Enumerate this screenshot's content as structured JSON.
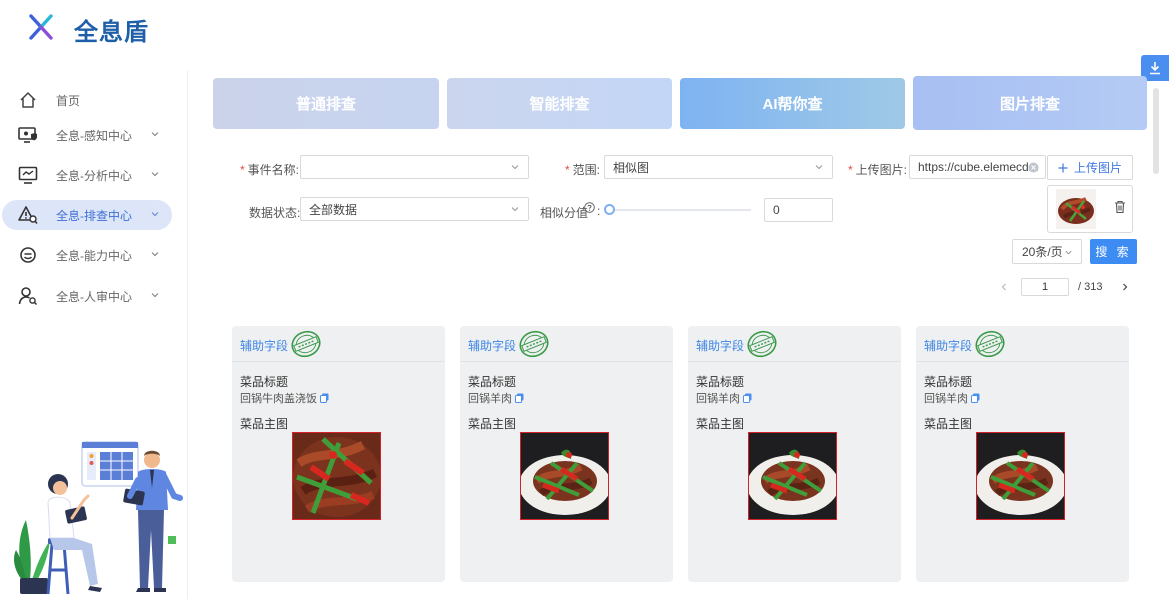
{
  "app": {
    "title": "全息盾"
  },
  "sidebar": {
    "items": [
      {
        "label": "首页",
        "icon": "home-icon",
        "active": false,
        "expandable": false
      },
      {
        "label": "全息-感知中心",
        "icon": "monitor-shield-icon",
        "active": false,
        "expandable": true
      },
      {
        "label": "全息-分析中心",
        "icon": "screen-chart-icon",
        "active": false,
        "expandable": true
      },
      {
        "label": "全息-排查中心",
        "icon": "warning-search-icon",
        "active": true,
        "expandable": true
      },
      {
        "label": "全息-能力中心",
        "icon": "ability-icon",
        "active": false,
        "expandable": true
      },
      {
        "label": "全息-人审中心",
        "icon": "user-search-icon",
        "active": false,
        "expandable": true
      }
    ]
  },
  "tabs": [
    {
      "label": "普通排查"
    },
    {
      "label": "智能排查"
    },
    {
      "label": "AI帮你查"
    },
    {
      "label": "图片排查"
    }
  ],
  "form": {
    "event_name": {
      "label": "事件名称:",
      "value": ""
    },
    "scope": {
      "label": "范围:",
      "value": "相似图"
    },
    "upload": {
      "label": "上传图片:",
      "value": "https://cube.elemecdn.",
      "button": "上传图片"
    },
    "data_status": {
      "label": "数据状态:",
      "value": "全部数据"
    },
    "similarity": {
      "label": "相似分值",
      "value": "0",
      "fraction": 0
    }
  },
  "controls": {
    "page_size": "20条/页",
    "search_label": "搜 索",
    "page_current": "1",
    "page_total": "/ 313"
  },
  "cards": [
    {
      "aux": "辅助字段",
      "title_label": "菜品标题",
      "dish": "回锅牛肉盖浇饭",
      "main_label": "菜品主图",
      "photo": "dark"
    },
    {
      "aux": "辅助字段",
      "title_label": "菜品标题",
      "dish": "回锅羊肉",
      "main_label": "菜品主图",
      "photo": "plate"
    },
    {
      "aux": "辅助字段",
      "title_label": "菜品标题",
      "dish": "回锅羊肉",
      "main_label": "菜品主图",
      "photo": "plate"
    },
    {
      "aux": "辅助字段",
      "title_label": "菜品标题",
      "dish": "回锅羊肉",
      "main_label": "菜品主图",
      "photo": "plate"
    }
  ],
  "colors": {
    "accent": "#3d8cf4",
    "brand_title": "#1f5fa8",
    "required": "#e04d4d",
    "active_nav_bg": "#dde6f8",
    "stamp_green": "#3a9a4a"
  }
}
